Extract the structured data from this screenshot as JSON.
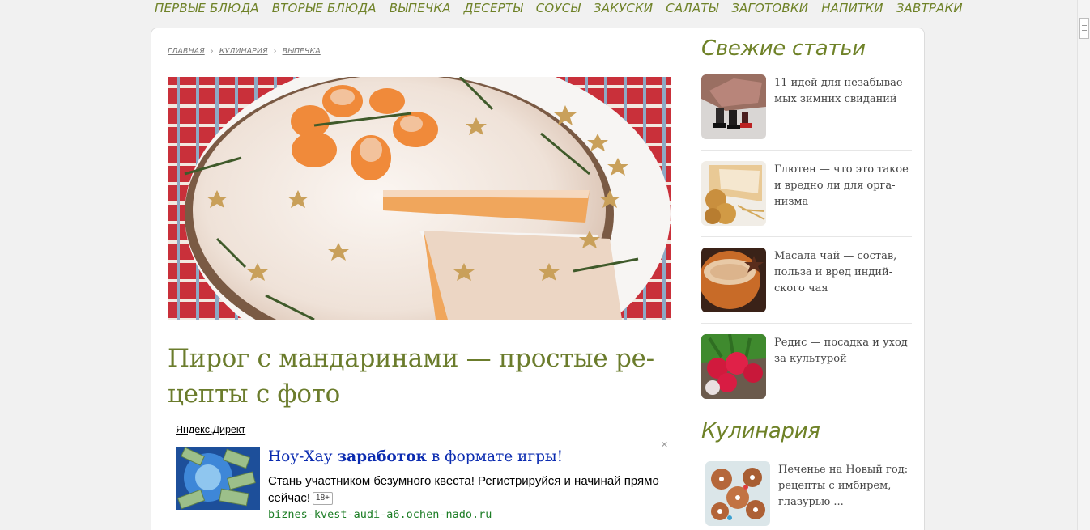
{
  "nav": {
    "items": [
      "ПЕРВЫЕ БЛЮДА",
      "ВТОРЫЕ БЛЮДА",
      "ВЫПЕЧКА",
      "ДЕСЕРТЫ",
      "СОУСЫ",
      "ЗАКУСКИ",
      "САЛАТЫ",
      "ЗАГОТОВКИ",
      "НАПИТКИ",
      "ЗАВТРАКИ"
    ]
  },
  "breadcrumb": {
    "home": "ГЛАВНАЯ",
    "section": "КУЛИНАРИЯ",
    "current": "ВЫПЕЧКА",
    "separator": "›"
  },
  "article": {
    "title": "Пирог с мандаринами — простые ре-\nцепты с фото"
  },
  "ad": {
    "source": "Яндекс.Директ",
    "close": "×",
    "title_part1": "Ноу-Хау ",
    "title_bold": "заработок",
    "title_part2": " в формате игры!",
    "text": "Стань участником безумного квеста! Регистрируйся и начинай прямо сейчас!",
    "age": "18+",
    "url": "biznes-kvest-audi-a6.ochen-nado.ru"
  },
  "sidebar": {
    "fresh_heading": "Свежие статьи",
    "fresh": [
      {
        "text": "11 идей для незабывае-\nмых зимних свиданий"
      },
      {
        "text": "Глютен — что это такое\nи вредно ли для орга-\nнизма"
      },
      {
        "text": "Масала чай — состав,\nпольза и вред индий-\nского чая"
      },
      {
        "text": "Редис — посадка и уход\nза культурой"
      }
    ],
    "cooking_heading": "Кулинария",
    "cooking": [
      {
        "text": "Печенье на Новый год:\nрецепты с имбирем,\nглазурью ..."
      }
    ]
  },
  "colors": {
    "accent": "#6f8228",
    "title": "#6b7c2c",
    "ad_link": "#0b2bb0",
    "ad_url": "#1c7d25"
  }
}
